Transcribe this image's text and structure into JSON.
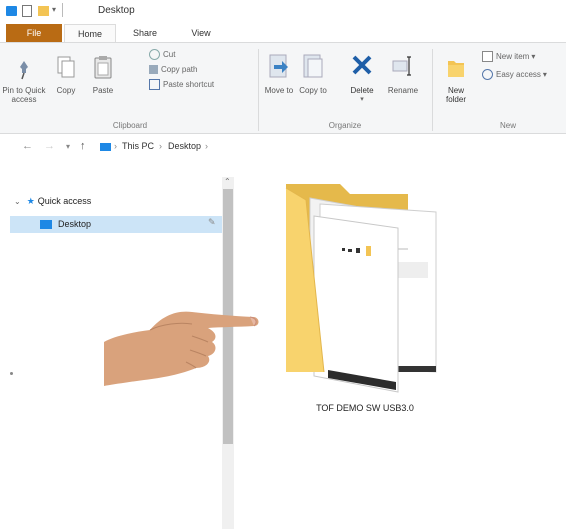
{
  "window": {
    "title": "Desktop"
  },
  "tabs": [
    "File",
    "Home",
    "Share",
    "View"
  ],
  "ribbon": {
    "clipboard": {
      "pin_label": "Pin to Quick access",
      "copy_label": "Copy",
      "paste_label": "Paste",
      "cut_label": "Cut",
      "copy_path_label": "Copy path",
      "paste_shortcut_label": "Paste shortcut",
      "group_label": "Clipboard"
    },
    "organize": {
      "move_to_label": "Move to",
      "copy_to_label": "Copy to",
      "delete_label": "Delete",
      "rename_label": "Rename",
      "group_label": "Organize"
    },
    "new": {
      "new_folder_label": "New folder",
      "new_item_label": "New item",
      "easy_access_label": "Easy access",
      "group_label": "New"
    }
  },
  "address": {
    "crumbs": [
      "This PC",
      "Desktop"
    ]
  },
  "nav": {
    "quick_access_label": "Quick access",
    "desktop_label": "Desktop"
  },
  "content": {
    "folder_name": "TOF DEMO SW USB3.0"
  },
  "colors": {
    "file_tab": "#b96b14",
    "selection": "#cce4f7",
    "folder_yellow": "#f8d36d",
    "folder_back": "#e5b94b",
    "accent_blue": "#1e88e5"
  }
}
